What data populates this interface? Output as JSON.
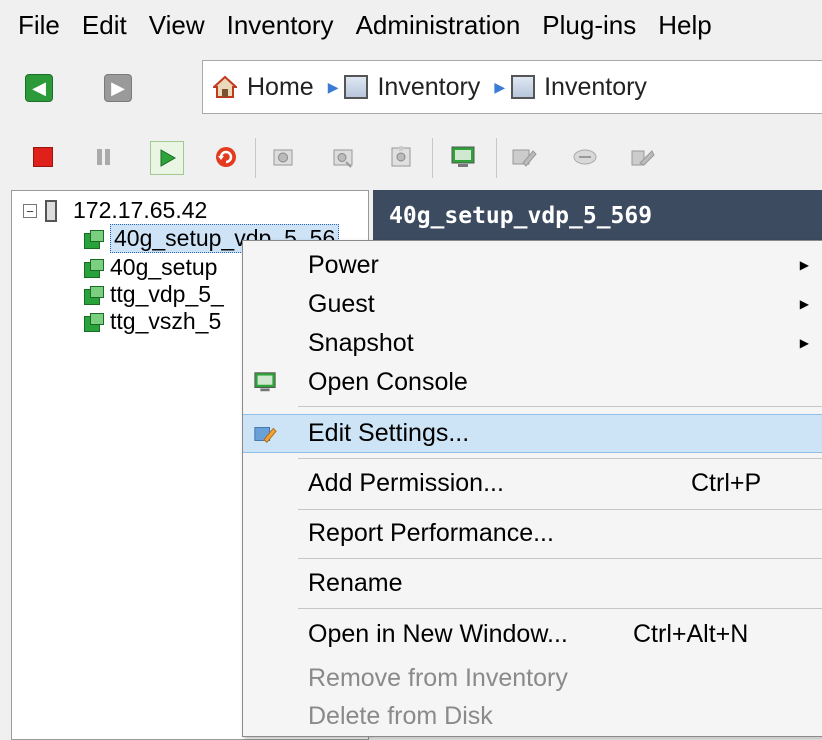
{
  "menu": {
    "items": [
      "File",
      "Edit",
      "View",
      "Inventory",
      "Administration",
      "Plug-ins",
      "Help"
    ]
  },
  "nav": {
    "breadcrumbs": [
      {
        "label": "Home",
        "icon": "home-icon"
      },
      {
        "label": "Inventory",
        "icon": "inventory-vms-icon"
      },
      {
        "label": "Inventory",
        "icon": "inventory-datastore-icon"
      }
    ]
  },
  "toolbar": {
    "buttons": [
      "power-off-icon",
      "suspend-icon",
      "power-on-icon",
      "reset-icon",
      "snapshot-icon",
      "revert-snapshot-icon",
      "snapshot-manager-icon",
      "console-icon",
      "edit-settings-icon",
      "migrate-icon",
      "vm-tools-icon"
    ]
  },
  "tree": {
    "host": "172.17.65.42",
    "vms": [
      "40g_setup_vdp_5_56",
      "40g_setup",
      "ttg_vdp_5_",
      "ttg_vszh_5"
    ]
  },
  "header": {
    "title": "40g_setup_vdp_5_569"
  },
  "context_menu": {
    "power": "Power",
    "guest": "Guest",
    "snapshot": "Snapshot",
    "open_console": "Open Console",
    "edit_settings": "Edit Settings...",
    "add_permission": "Add Permission...",
    "add_permission_shortcut": "Ctrl+P",
    "report_performance": "Report Performance...",
    "rename": "Rename",
    "open_new_window": "Open in New Window...",
    "open_new_window_shortcut": "Ctrl+Alt+N",
    "remove_inventory": "Remove from Inventory",
    "delete_disk": "Delete from Disk"
  },
  "colors": {
    "highlight": "#cde4f7",
    "header_bg": "#3c4b60",
    "vm_green": "#29a23b"
  }
}
